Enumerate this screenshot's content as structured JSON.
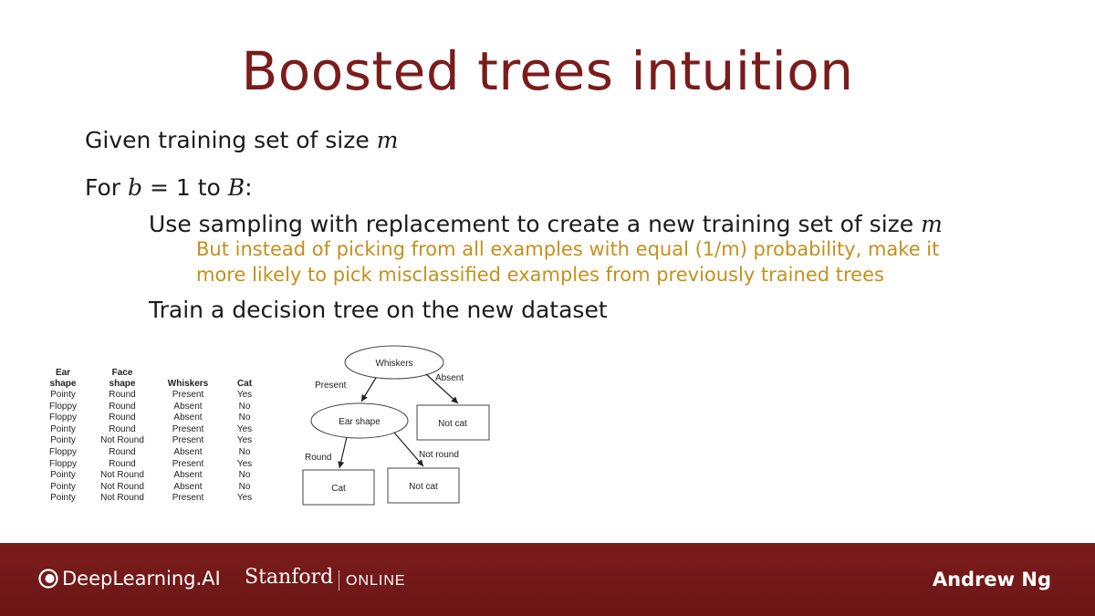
{
  "slide": {
    "title": "Boosted trees intuition",
    "lines": {
      "given": {
        "text": "Given training set of size ",
        "var": "m"
      },
      "for_loop": {
        "prefix": "For ",
        "var_b": "b",
        "middle": " = 1 to ",
        "var_B": "B",
        "suffix": ":"
      },
      "sampling": {
        "text": "Use sampling with replacement to create a new training set of size ",
        "var": "m"
      },
      "note_line1": "But instead of picking from all examples with equal (1/m) probability, make it",
      "note_line2": "more likely to pick misclassified examples from previously trained trees",
      "train": "Train a decision tree on the new dataset"
    }
  },
  "table": {
    "headers": {
      "ear": [
        "Ear",
        "shape"
      ],
      "face": [
        "Face",
        "shape"
      ],
      "whiskers": "Whiskers",
      "cat": "Cat"
    },
    "rows": [
      [
        "Pointy",
        "Round",
        "Present",
        "Yes"
      ],
      [
        "Floppy",
        "Round",
        "Absent",
        "No"
      ],
      [
        "Floppy",
        "Round",
        "Absent",
        "No"
      ],
      [
        "Pointy",
        "Round",
        "Present",
        "Yes"
      ],
      [
        "Pointy",
        "Not Round",
        "Present",
        "Yes"
      ],
      [
        "Floppy",
        "Round",
        "Absent",
        "No"
      ],
      [
        "Floppy",
        "Round",
        "Present",
        "Yes"
      ],
      [
        "Pointy",
        "Not Round",
        "Absent",
        "No"
      ],
      [
        "Pointy",
        "Not Round",
        "Absent",
        "No"
      ],
      [
        "Pointy",
        "Not Round",
        "Present",
        "Yes"
      ]
    ]
  },
  "tree": {
    "root": "Whiskers",
    "edge_left": "Present",
    "edge_right": "Absent",
    "mid_node": "Ear shape",
    "right_leaf": "Not cat",
    "edge_round": "Round",
    "edge_not_round": "Not round",
    "leaf_cat": "Cat",
    "leaf_not_cat": "Not cat"
  },
  "footer": {
    "brand": "DeepLearning.AI",
    "stanford": "Stanford",
    "online": "ONLINE",
    "presenter": "Andrew Ng"
  },
  "colors": {
    "title": "#7b1c1c",
    "note": "#c4901c",
    "footer": "#721919"
  }
}
